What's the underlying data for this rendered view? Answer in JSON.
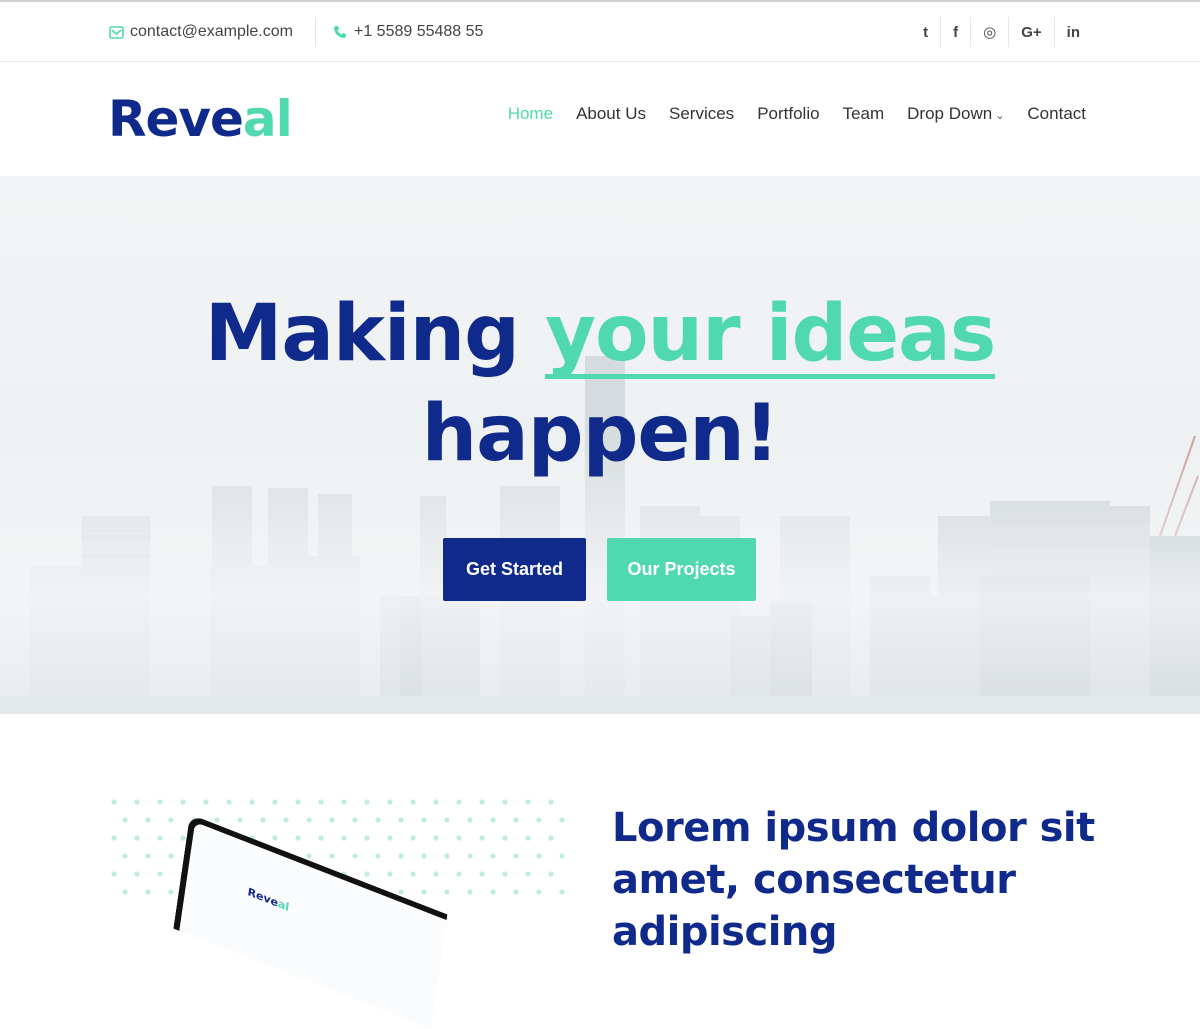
{
  "topbar": {
    "email": "contact@example.com",
    "phone": "+1 5589 55488 55",
    "social": [
      {
        "icon": "twitter-icon",
        "glyph": "t"
      },
      {
        "icon": "facebook-icon",
        "glyph": "f"
      },
      {
        "icon": "instagram-icon",
        "glyph": "◎"
      },
      {
        "icon": "google-plus-icon",
        "glyph": "G+"
      },
      {
        "icon": "linkedin-icon",
        "glyph": "in"
      }
    ]
  },
  "header": {
    "logo_part1": "Reve",
    "logo_part2": "al",
    "nav": [
      "Home",
      "About Us",
      "Services",
      "Portfolio",
      "Team",
      "Drop Down",
      "Contact"
    ],
    "active": "Home"
  },
  "hero": {
    "title_part1": "Making ",
    "title_highlight": "your ideas",
    "title_part2": "happen!",
    "primary_button": "Get Started",
    "secondary_button": "Our Projects"
  },
  "about": {
    "heading": "Lorem ipsum dolor sit amet, consectetur adipiscing",
    "laptop_logo_part1": "Reve",
    "laptop_logo_part2": "al"
  },
  "colors": {
    "primary": "#0f2a8a",
    "accent": "#50d8af"
  }
}
